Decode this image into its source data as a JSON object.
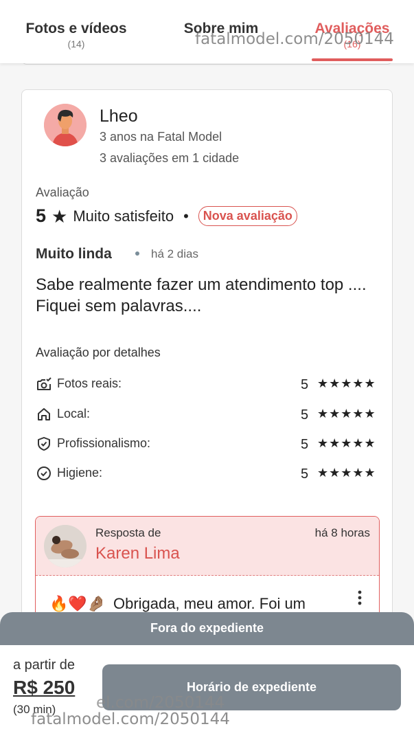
{
  "tabs": [
    {
      "label": "Fotos e vídeos",
      "count": "(14)"
    },
    {
      "label": "Sobre mim",
      "count": ""
    },
    {
      "label": "Avaliações",
      "count": "(16)"
    }
  ],
  "watermark": "fatalmodel.com/2050144",
  "watermark_partial": "el.com/2050144",
  "review": {
    "reviewer_name": "Lheo",
    "reviewer_tenure": "3 anos na Fatal Model",
    "reviewer_count": "3 avaliações em 1 cidade",
    "rating_label": "Avaliação",
    "rating_value": "5",
    "rating_star": "★",
    "rating_text": "Muito satisfeito",
    "rating_separator": "•",
    "badge": "Nova avaliação",
    "title": "Muito linda",
    "time": "há 2 dias",
    "body": "Sabe realmente fazer um atendimento top .... Fiquei sem palavras...."
  },
  "details": {
    "title": "Avaliação por detalhes",
    "items": [
      {
        "icon": "camera-check-icon",
        "label": "Fotos reais:",
        "score": "5",
        "stars": "★★★★★"
      },
      {
        "icon": "home-icon",
        "label": "Local:",
        "score": "5",
        "stars": "★★★★★"
      },
      {
        "icon": "shield-check-icon",
        "label": "Profissionalismo:",
        "score": "5",
        "stars": "★★★★★"
      },
      {
        "icon": "check-circle-icon",
        "label": "Higiene:",
        "score": "5",
        "stars": "★★★★★"
      }
    ]
  },
  "response": {
    "label": "Resposta de",
    "name": "Karen Lima",
    "time": "há 8 horas",
    "emojis": "🔥❤️🤌🏽",
    "text": "Obrigada, meu amor. Foi um"
  },
  "bottom": {
    "status": "Fora do expediente",
    "price_prefix": "a partir de",
    "price": "R$ 250",
    "duration": "(30 min)",
    "button": "Horário de expediente"
  },
  "colors": {
    "accent": "#e05d5d",
    "disabled": "#7d8790",
    "response_bg": "#fbe3e3"
  }
}
